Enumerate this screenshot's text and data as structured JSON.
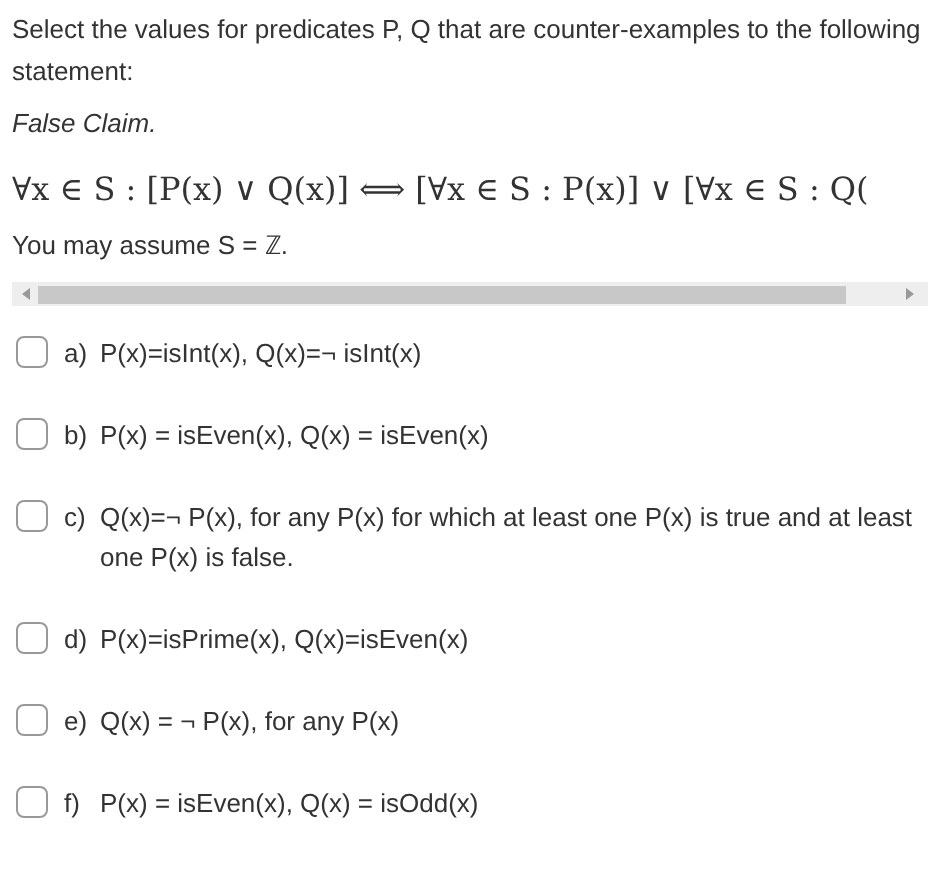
{
  "question": {
    "prompt": "Select the values for predicates P, Q that are counter-examples to the following statement:",
    "claim_label": "False Claim.",
    "formula": "∀x ∈ S : [P(x) ∨ Q(x)]  ⟺  [∀x ∈ S : P(x)] ∨ [∀x ∈ S : Q(",
    "assumption": "You may assume S = ℤ."
  },
  "options": [
    {
      "letter": "a)",
      "text": "P(x)=isInt(x), Q(x)=¬ isInt(x)",
      "checked": false
    },
    {
      "letter": "b)",
      "text": "P(x) = isEven(x), Q(x) = isEven(x)",
      "checked": false
    },
    {
      "letter": "c)",
      "text": "Q(x)=¬ P(x), for any P(x) for which at least one P(x) is true and at least one P(x) is false.",
      "checked": false
    },
    {
      "letter": "d)",
      "text": "P(x)=isPrime(x), Q(x)=isEven(x)",
      "checked": false
    },
    {
      "letter": "e)",
      "text": "Q(x) = ¬ P(x), for any P(x)",
      "checked": false
    },
    {
      "letter": "f)",
      "text": "P(x) = isEven(x), Q(x) = isOdd(x)",
      "checked": false
    }
  ]
}
